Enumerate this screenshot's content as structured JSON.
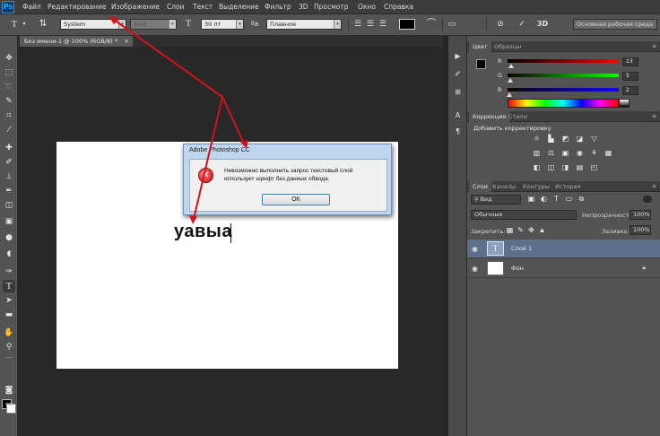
{
  "app": {
    "logo": "Ps"
  },
  "menu": [
    "Файл",
    "Редактирование",
    "Изображение",
    "Слои",
    "Текст",
    "Выделение",
    "Фильтр",
    "3D",
    "Просмотр",
    "Окно",
    "Справка"
  ],
  "options": {
    "font_family": "System",
    "font_style": "Bold",
    "font_size": "30 пт",
    "antialias": "Плавное",
    "workspace": "Основная рабочая среда"
  },
  "document": {
    "tab_title": "Без имени-1 @ 100% (RGB/8) *",
    "close": "×",
    "canvas_text": "уавыа"
  },
  "color_panel": {
    "tabs": [
      "Цвет",
      "Образцы"
    ],
    "channels": [
      {
        "label": "R",
        "value": "13"
      },
      {
        "label": "G",
        "value": "5"
      },
      {
        "label": "B",
        "value": "2"
      }
    ]
  },
  "adjustments_panel": {
    "tabs": [
      "Коррекция",
      "Стили"
    ],
    "heading": "Добавить корректировку"
  },
  "layers_panel": {
    "tabs": [
      "Слои",
      "Каналы",
      "Контуры",
      "История"
    ],
    "filter": "Вид",
    "blend_mode": "Обычные",
    "opacity_label": "Непрозрачность:",
    "opacity_value": "100%",
    "lock_label": "Закрепить:",
    "fill_label": "Заливка:",
    "fill_value": "100%",
    "layers": [
      {
        "name": "Слой 1",
        "thumb": "T",
        "selected": true
      },
      {
        "name": "Фон",
        "thumb": "",
        "selected": false
      }
    ]
  },
  "dialog": {
    "title": "Adobe Photoshop CC",
    "message": "Невозможно выполнить запрос текстовый слой использует шрифт без данных обвода.",
    "ok": "ОК"
  },
  "colors": {
    "accent_arrow": "#d0121b",
    "selected_layer": "#5c708c"
  }
}
